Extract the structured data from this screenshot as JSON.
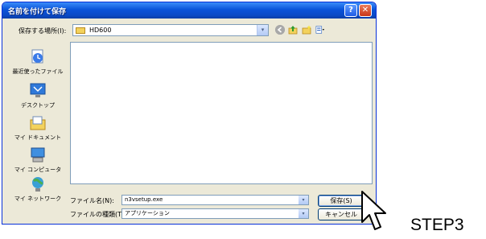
{
  "dialog": {
    "title": "名前を付けて保存",
    "title_buttons": {
      "help": "?",
      "close": "✕"
    }
  },
  "lookin": {
    "label": "保存する場所(I):",
    "value": "HD600",
    "dropdown_arrow": "▾"
  },
  "toolbar": {
    "icons": [
      "back-icon",
      "up-folder-icon",
      "new-folder-icon",
      "views-menu-icon"
    ]
  },
  "places": [
    {
      "label": "最近使ったファイル",
      "icon": "recent-documents-icon"
    },
    {
      "label": "デスクトップ",
      "icon": "desktop-icon"
    },
    {
      "label": "マイ ドキュメント",
      "icon": "my-documents-icon"
    },
    {
      "label": "マイ コンピュータ",
      "icon": "my-computer-icon"
    },
    {
      "label": "マイ ネットワーク",
      "icon": "my-network-icon"
    }
  ],
  "filename": {
    "label": "ファイル名(N):",
    "value": "n3vsetup.exe"
  },
  "filetype": {
    "label": "ファイルの種類(T):",
    "value": "アプリケーション"
  },
  "buttons": {
    "save": "保存(S)",
    "cancel": "キャンセル"
  },
  "annotation": {
    "step": "STEP3"
  },
  "colors": {
    "titlebar": "#0a53d9",
    "dialog_bg": "#ece9d8",
    "field_border": "#7f9db9"
  }
}
